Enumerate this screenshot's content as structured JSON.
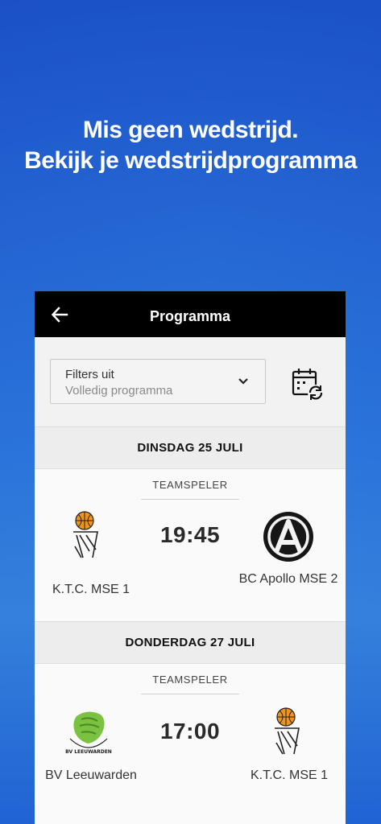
{
  "headline": {
    "line1": "Mis geen wedstrijd.",
    "line2": "Bekijk je wedstrijdprogramma"
  },
  "appbar": {
    "title": "Programma"
  },
  "filter": {
    "label": "Filters uit",
    "value": "Volledig programma"
  },
  "icons": {
    "back": "arrow-left-icon",
    "chevron": "chevron-down-icon",
    "calendar": "calendar-refresh-icon"
  },
  "days": [
    {
      "date": "DINSDAG 25 JULI",
      "match": {
        "role": "TEAMSPELER",
        "time": "19:45",
        "home": "K.T.C. MSE 1",
        "away": "BC Apollo MSE 2"
      }
    },
    {
      "date": "DONDERDAG 27 JULI",
      "match": {
        "role": "TEAMSPELER",
        "time": "17:00",
        "home": "BV Leeuwarden",
        "away": "K.T.C. MSE 1"
      }
    }
  ],
  "colors": {
    "brand_blue": "#1f5fd3",
    "appbar": "#000000",
    "basketball_orange": "#f0941e",
    "leeuwarden_green": "#7cc242"
  }
}
